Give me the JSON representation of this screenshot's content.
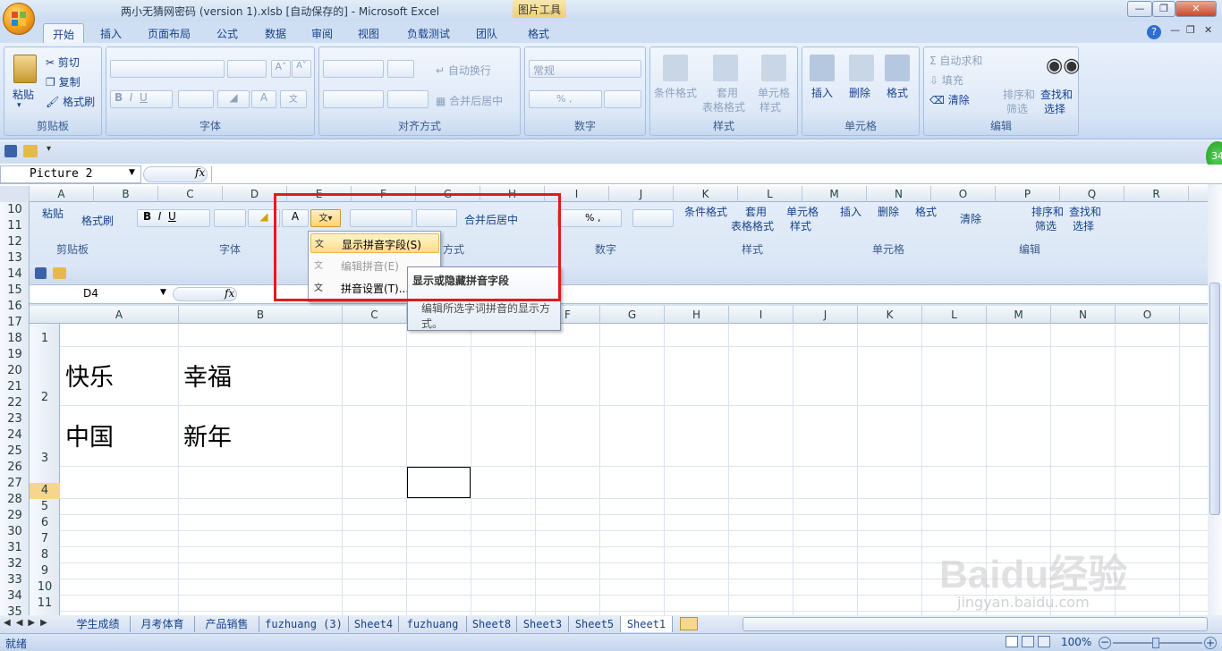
{
  "window": {
    "title": "两小无猜网密码 (version 1).xlsb [自动保存的] - Microsoft Excel",
    "contextual_tools": "图片工具"
  },
  "tabs": [
    "开始",
    "插入",
    "页面布局",
    "公式",
    "数据",
    "审阅",
    "视图",
    "负载测试",
    "团队",
    "格式"
  ],
  "ribbon": {
    "clipboard": {
      "label": "剪贴板",
      "paste": "粘贴",
      "cut": "剪切",
      "copy": "复制",
      "format_painter": "格式刷"
    },
    "font": {
      "label": "字体"
    },
    "alignment": {
      "label": "对齐方式",
      "wrap": "自动换行",
      "merge": "合并后居中"
    },
    "number": {
      "label": "数字",
      "format": "常规"
    },
    "styles": {
      "label": "样式",
      "cond": "条件格式",
      "table1": "套用",
      "table2": "表格格式",
      "cell1": "单元格",
      "cell2": "样式"
    },
    "cells": {
      "label": "单元格",
      "insert": "插入",
      "delete": "删除",
      "format": "格式"
    },
    "editing": {
      "label": "编辑",
      "autosum": "自动求和",
      "fill": "填充",
      "clear": "清除",
      "sort1": "排序和",
      "sort2": "筛选",
      "find1": "查找和",
      "find2": "选择"
    }
  },
  "namebox": "Picture 2",
  "fx": "fx",
  "columns": [
    "A",
    "B",
    "C",
    "D",
    "E",
    "F",
    "G",
    "H",
    "I",
    "J",
    "K",
    "L",
    "M",
    "N",
    "O",
    "P",
    "Q",
    "R"
  ],
  "rows": [
    "10",
    "11",
    "12",
    "13",
    "14",
    "15",
    "16",
    "17",
    "18",
    "19",
    "20",
    "21",
    "22",
    "23",
    "24",
    "25",
    "26",
    "27",
    "28",
    "29",
    "30",
    "31",
    "32",
    "33",
    "34",
    "35"
  ],
  "inner": {
    "namebox": "D4",
    "clipboard_label": "剪贴板",
    "paste": "粘贴",
    "format_painter": "格式刷",
    "font_label": "字体",
    "merge": "合并后居中",
    "align_label_part": "方式",
    "number_label": "数字",
    "cond": "条件格式",
    "table1": "套用",
    "table2": "表格格式",
    "cell1": "单元格",
    "cell2": "样式",
    "styles_label": "样式",
    "insert": "插入",
    "delete": "删除",
    "format": "格式",
    "cells_label": "单元格",
    "clear": "清除",
    "sort1": "排序和",
    "sort2": "筛选",
    "find1": "查找和",
    "find2": "选择",
    "editing_label": "编辑",
    "columns": [
      "A",
      "B",
      "C",
      "D",
      "E",
      "F",
      "G",
      "H",
      "I",
      "J",
      "K",
      "L",
      "M",
      "N",
      "O"
    ],
    "rows": [
      "1",
      "2",
      "3",
      "4",
      "5",
      "6",
      "7",
      "8",
      "9",
      "10",
      "11"
    ],
    "cells": {
      "a2": "快乐",
      "b2": "幸福",
      "a3": "中国",
      "b3": "新年"
    }
  },
  "phonetic_menu": {
    "show": "显示拼音字段(S)",
    "edit": "编辑拼音(E)",
    "settings": "拼音设置(T)..."
  },
  "tooltip": {
    "title": "显示或隐藏拼音字段",
    "body": "编辑所选字词拼音的显示方式。"
  },
  "sheet_tabs": [
    "学生成绩",
    "月考体育",
    "产品销售",
    "fuzhuang (3)",
    "Sheet4",
    "fuzhuang",
    "Sheet8",
    "Sheet3",
    "Sheet5",
    "Sheet1"
  ],
  "status": {
    "ready": "就绪",
    "zoom": "100%"
  },
  "badge": "34",
  "watermark": {
    "text": "Baidu经验",
    "url": "jingyan.baidu.com"
  }
}
